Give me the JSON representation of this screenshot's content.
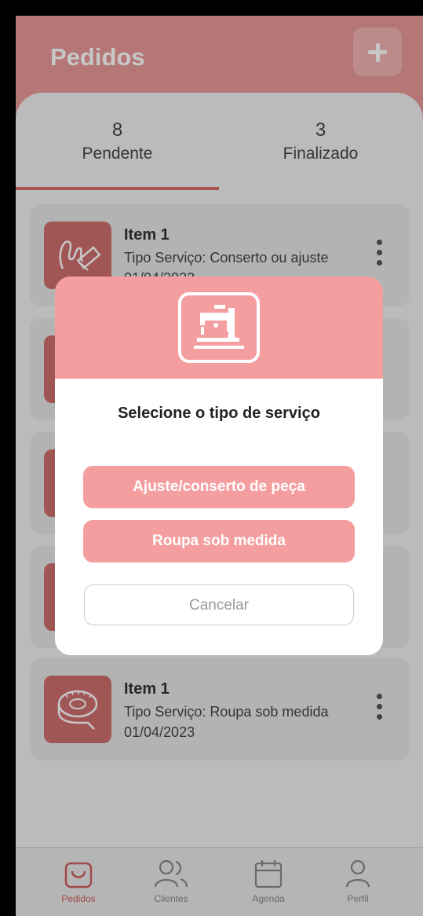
{
  "header": {
    "title": "Pedidos",
    "add_icon": "plus-icon"
  },
  "tabs": [
    {
      "count": "8",
      "label": "Pendente"
    },
    {
      "count": "3",
      "label": "Finalizado"
    }
  ],
  "orders": [
    {
      "title": "Item 1",
      "type": "Tipo Serviço: Conserto ou ajuste",
      "date": "01/04/2023",
      "icon": "needle-thread-icon"
    },
    {
      "title": "Item 1",
      "type": "Tipo Serviço: Roupa sob medida",
      "date": "01/04/2023",
      "icon": "measuring-tape-icon"
    }
  ],
  "modal": {
    "icon": "sewing-machine-icon",
    "title": "Selecione o tipo de serviço",
    "option1": "Ajuste/conserto de peça",
    "option2": "Roupa sob medida",
    "cancel": "Cancelar"
  },
  "nav": [
    {
      "label": "Pedidos",
      "icon": "bag-icon"
    },
    {
      "label": "Clientes",
      "icon": "users-icon"
    },
    {
      "label": "Agenda",
      "icon": "calendar-icon"
    },
    {
      "label": "Perfil",
      "icon": "person-icon"
    }
  ],
  "colors": {
    "primary": "#e89898",
    "accent": "#cf6f6f",
    "modal_accent": "#f59ea0"
  }
}
